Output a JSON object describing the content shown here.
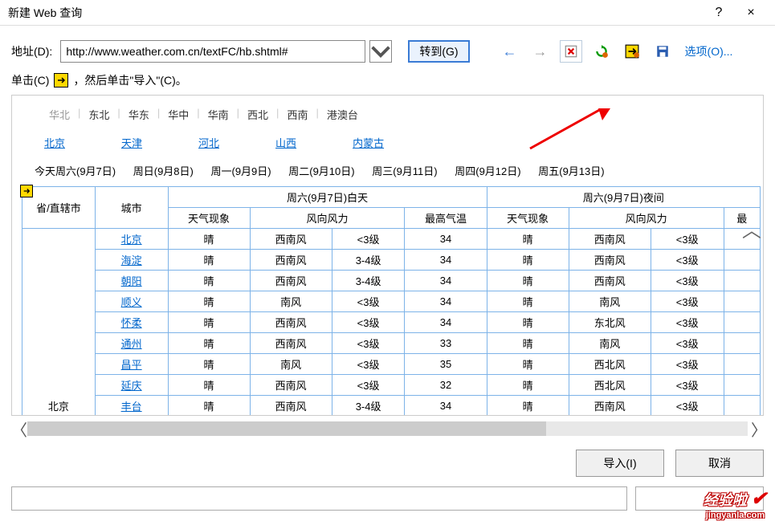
{
  "titlebar": {
    "title": "新建 Web 查询",
    "help": "?",
    "close": "×"
  },
  "toolbar": {
    "addr_label": "地址(D):",
    "url": "http://www.weather.com.cn/textFC/hb.shtml#",
    "go_label": "转到(G)",
    "back_icon": "←",
    "fwd_icon": "→",
    "options_label": "选项(O)..."
  },
  "instr": {
    "pre": "单击(C)",
    "post": "，然后单击\"导入\"(C)。"
  },
  "regions": [
    "华北",
    "东北",
    "华东",
    "华中",
    "华南",
    "西北",
    "西南",
    "港澳台"
  ],
  "active_region_index": 0,
  "provinces": [
    "北京",
    "天津",
    "河北",
    "山西",
    "内蒙古"
  ],
  "days": [
    "今天周六(9月7日)",
    "周日(9月8日)",
    "周一(9月9日)",
    "周二(9月10日)",
    "周三(9月11日)",
    "周四(9月12日)",
    "周五(9月13日)"
  ],
  "table": {
    "header1": {
      "prov": "省/直辖市",
      "city": "城市",
      "day": "周六(9月7日)白天",
      "night": "周六(9月7日)夜间"
    },
    "header2": {
      "c1": "天气现象",
      "c2": "风向风力",
      "c3": "最高气温",
      "c4": "天气现象",
      "c5": "风向风力",
      "c6": "最"
    },
    "prov_cell": "北京",
    "rows": [
      {
        "city": "北京",
        "d1": "晴",
        "d2a": "西南风",
        "d2b": "<3级",
        "d3": "34",
        "n1": "晴",
        "n2a": "西南风",
        "n2b": "<3级"
      },
      {
        "city": "海淀",
        "d1": "晴",
        "d2a": "西南风",
        "d2b": "3-4级",
        "d3": "34",
        "n1": "晴",
        "n2a": "西南风",
        "n2b": "<3级"
      },
      {
        "city": "朝阳",
        "d1": "晴",
        "d2a": "西南风",
        "d2b": "3-4级",
        "d3": "34",
        "n1": "晴",
        "n2a": "西南风",
        "n2b": "<3级"
      },
      {
        "city": "顺义",
        "d1": "晴",
        "d2a": "南风",
        "d2b": "<3级",
        "d3": "34",
        "n1": "晴",
        "n2a": "南风",
        "n2b": "<3级"
      },
      {
        "city": "怀柔",
        "d1": "晴",
        "d2a": "西南风",
        "d2b": "<3级",
        "d3": "34",
        "n1": "晴",
        "n2a": "东北风",
        "n2b": "<3级"
      },
      {
        "city": "通州",
        "d1": "晴",
        "d2a": "西南风",
        "d2b": "<3级",
        "d3": "33",
        "n1": "晴",
        "n2a": "南风",
        "n2b": "<3级"
      },
      {
        "city": "昌平",
        "d1": "晴",
        "d2a": "南风",
        "d2b": "<3级",
        "d3": "35",
        "n1": "晴",
        "n2a": "西北风",
        "n2b": "<3级"
      },
      {
        "city": "延庆",
        "d1": "晴",
        "d2a": "西南风",
        "d2b": "<3级",
        "d3": "32",
        "n1": "晴",
        "n2a": "西北风",
        "n2b": "<3级"
      },
      {
        "city": "丰台",
        "d1": "晴",
        "d2a": "西南风",
        "d2b": "3-4级",
        "d3": "34",
        "n1": "晴",
        "n2a": "西南风",
        "n2b": "<3级"
      }
    ]
  },
  "footer": {
    "import": "导入(I)",
    "cancel": "取消"
  },
  "watermark": {
    "main": "经验啦",
    "sub": "jingyanla.com",
    "check": "✔"
  }
}
